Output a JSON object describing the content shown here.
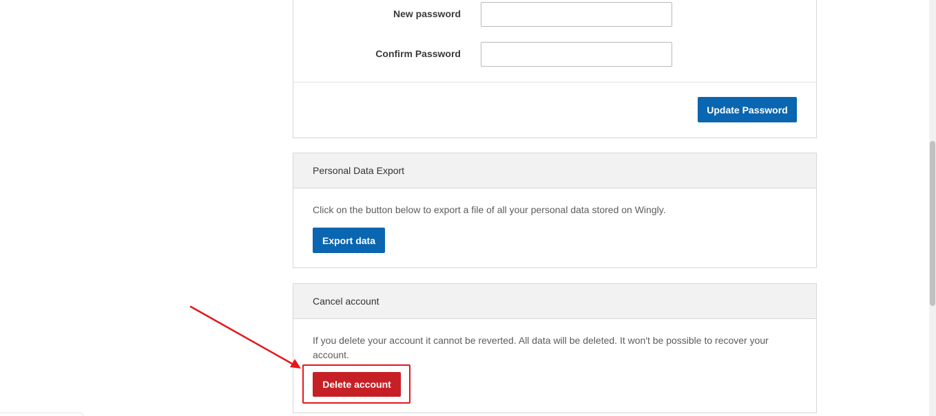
{
  "password_form": {
    "new_password_label": "New password",
    "new_password_value": "",
    "confirm_password_label": "Confirm Password",
    "confirm_password_value": "",
    "update_button_label": "Update Password"
  },
  "personal_data_export": {
    "title": "Personal Data Export",
    "description": "Click on the button below to export a file of all your personal data stored on Wingly.",
    "export_button_label": "Export data"
  },
  "cancel_account": {
    "title": "Cancel account",
    "description": "If you delete your account it cannot be reverted. All data will be deleted. It won't be possible to recover your account.",
    "delete_button_label": "Delete account"
  },
  "colors": {
    "primary_button": "#0a66b0",
    "danger_button": "#c62026",
    "annotation_red": "#e8141b",
    "section_header_bg": "#f2f2f2"
  }
}
